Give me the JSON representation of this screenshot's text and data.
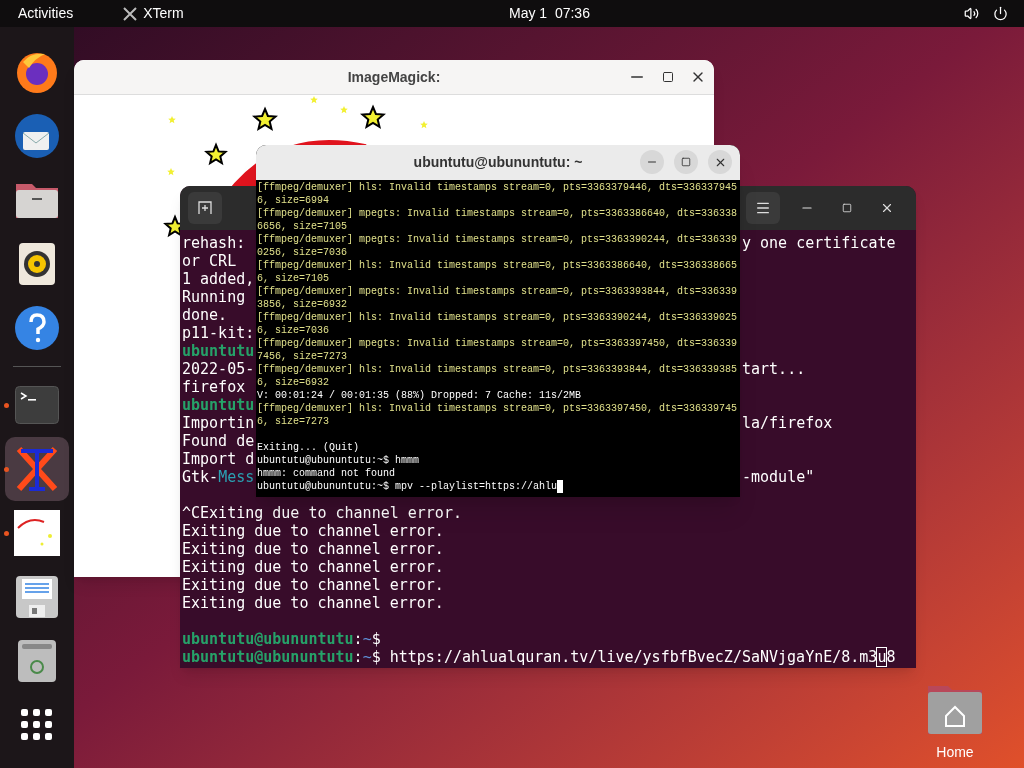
{
  "top_bar": {
    "activities": "Activities",
    "app_name": "XTerm",
    "clock": "May 1  07:36"
  },
  "dock": [
    {
      "running": false,
      "selected": false
    },
    {
      "running": false,
      "selected": false
    },
    {
      "running": false,
      "selected": false
    },
    {
      "running": false,
      "selected": false
    },
    {
      "running": false,
      "selected": false
    },
    {
      "running": true,
      "selected": false
    },
    {
      "running": true,
      "selected": true
    },
    {
      "running": true,
      "selected": false
    },
    {
      "running": false,
      "selected": false
    },
    {
      "running": false,
      "selected": false
    },
    {
      "running": false,
      "selected": false
    }
  ],
  "image_window": {
    "title": "ImageMagick:"
  },
  "back_terminal": {
    "lines": [
      {
        "left": [
          {
            "kind": "plain",
            "text": "rehash: "
          }
        ],
        "right": "y one certificate"
      },
      {
        "left": [
          {
            "kind": "plain",
            "text": "or CRL"
          }
        ]
      },
      {
        "left": [
          {
            "kind": "plain",
            "text": "1 added,"
          }
        ]
      },
      {
        "left": [
          {
            "kind": "plain",
            "text": "Running "
          }
        ]
      },
      {
        "left": [
          {
            "kind": "plain",
            "text": "done."
          }
        ]
      },
      {
        "left": [
          {
            "kind": "plain",
            "text": "p11-kit:"
          }
        ]
      },
      {
        "left": [
          {
            "kind": "user",
            "text": "ubuntutu"
          }
        ]
      },
      {
        "left": [
          {
            "kind": "plain",
            "text": "2022-05-"
          }
        ],
        "right": "tart..."
      },
      {
        "left": [
          {
            "kind": "plain",
            "text": "firefox "
          }
        ]
      },
      {
        "left": [
          {
            "kind": "user",
            "text": "ubuntutu"
          }
        ]
      },
      {
        "left": [
          {
            "kind": "plain",
            "text": "Importin"
          }
        ],
        "right": "la/firefox"
      },
      {
        "left": [
          {
            "kind": "plain",
            "text": "Found de"
          }
        ]
      },
      {
        "left": [
          {
            "kind": "plain",
            "text": "Import d"
          }
        ]
      },
      {
        "left": [
          {
            "kind": "plain",
            "text": "Gtk-"
          },
          {
            "kind": "label",
            "text": "Mess"
          }
        ],
        "right": "-module\""
      },
      {
        "kind": "blank"
      },
      {
        "left": [
          {
            "kind": "plain",
            "text": "^CExiting due to channel error."
          }
        ]
      },
      {
        "left": [
          {
            "kind": "plain",
            "text": "Exiting due to channel error."
          }
        ]
      },
      {
        "left": [
          {
            "kind": "plain",
            "text": "Exiting due to channel error."
          }
        ]
      },
      {
        "left": [
          {
            "kind": "plain",
            "text": "Exiting due to channel error."
          }
        ]
      },
      {
        "left": [
          {
            "kind": "plain",
            "text": "Exiting due to channel error."
          }
        ]
      },
      {
        "left": [
          {
            "kind": "plain",
            "text": "Exiting due to channel error."
          }
        ]
      },
      {
        "kind": "blank"
      },
      {
        "left": [
          {
            "kind": "user",
            "text": "ubuntutu@ubununtutu"
          },
          {
            "kind": "plain",
            "text": ":"
          },
          {
            "kind": "path",
            "text": "~"
          },
          {
            "kind": "plain",
            "text": "$"
          }
        ]
      },
      {
        "left": [
          {
            "kind": "user",
            "text": "ubuntutu@ubununtutu"
          },
          {
            "kind": "plain",
            "text": ":"
          },
          {
            "kind": "path",
            "text": "~"
          },
          {
            "kind": "plain",
            "text": "$ https://ahlualquran.tv/live/ysfbfBvecZ/SaNVjgaYnE/8.m3"
          },
          {
            "kind": "cursor",
            "text": "u"
          },
          {
            "kind": "plain",
            "text": "8"
          }
        ]
      }
    ]
  },
  "xterm": {
    "title": "ubuntutu@ubununtutu: ~",
    "lines": [
      {
        "kind": "log",
        "text": "[ffmpeg/demuxer] hls: Invalid timestamps stream=0, pts=3363379446, dts=336337945"
      },
      {
        "kind": "log",
        "text": "6, size=6994"
      },
      {
        "kind": "log",
        "text": "[ffmpeg/demuxer] mpegts: Invalid timestamps stream=0, pts=3363386640, dts=336338"
      },
      {
        "kind": "log",
        "text": "6656, size=7105"
      },
      {
        "kind": "log",
        "text": "[ffmpeg/demuxer] mpegts: Invalid timestamps stream=0, pts=3363390244, dts=336339"
      },
      {
        "kind": "log",
        "text": "0256, size=7036"
      },
      {
        "kind": "log",
        "text": "[ffmpeg/demuxer] hls: Invalid timestamps stream=0, pts=3363386640, dts=336338665"
      },
      {
        "kind": "log",
        "text": "6, size=7105"
      },
      {
        "kind": "log",
        "text": "[ffmpeg/demuxer] mpegts: Invalid timestamps stream=0, pts=3363393844, dts=336339"
      },
      {
        "kind": "log",
        "text": "3856, size=6932"
      },
      {
        "kind": "log",
        "text": "[ffmpeg/demuxer] hls: Invalid timestamps stream=0, pts=3363390244, dts=336339025"
      },
      {
        "kind": "log",
        "text": "6, size=7036"
      },
      {
        "kind": "log",
        "text": "[ffmpeg/demuxer] mpegts: Invalid timestamps stream=0, pts=3363397450, dts=336339"
      },
      {
        "kind": "log",
        "text": "7456, size=7273"
      },
      {
        "kind": "log",
        "text": "[ffmpeg/demuxer] hls: Invalid timestamps stream=0, pts=3363393844, dts=336339385"
      },
      {
        "kind": "log",
        "text": "6, size=6932"
      },
      {
        "kind": "plain",
        "text": "V: 00:01:24 / 00:01:35 (88%) Dropped: 7 Cache: 11s/2MB"
      },
      {
        "kind": "log",
        "text": "[ffmpeg/demuxer] hls: Invalid timestamps stream=0, pts=3363397450, dts=336339745"
      },
      {
        "kind": "log",
        "text": "6, size=7273"
      },
      {
        "kind": "blank"
      },
      {
        "kind": "plain",
        "text": "Exiting... (Quit)"
      },
      {
        "kind": "plain",
        "text": "ubuntutu@ubununtutu:~$ hmmm"
      },
      {
        "kind": "plain",
        "text": "hmmm: command not found"
      },
      {
        "kind": "plain",
        "text": "ubuntutu@ubununtutu:~$ mpv --playlist=https://ahlu",
        "cursor": true
      }
    ]
  },
  "desktop": {
    "home_label": "Home"
  }
}
